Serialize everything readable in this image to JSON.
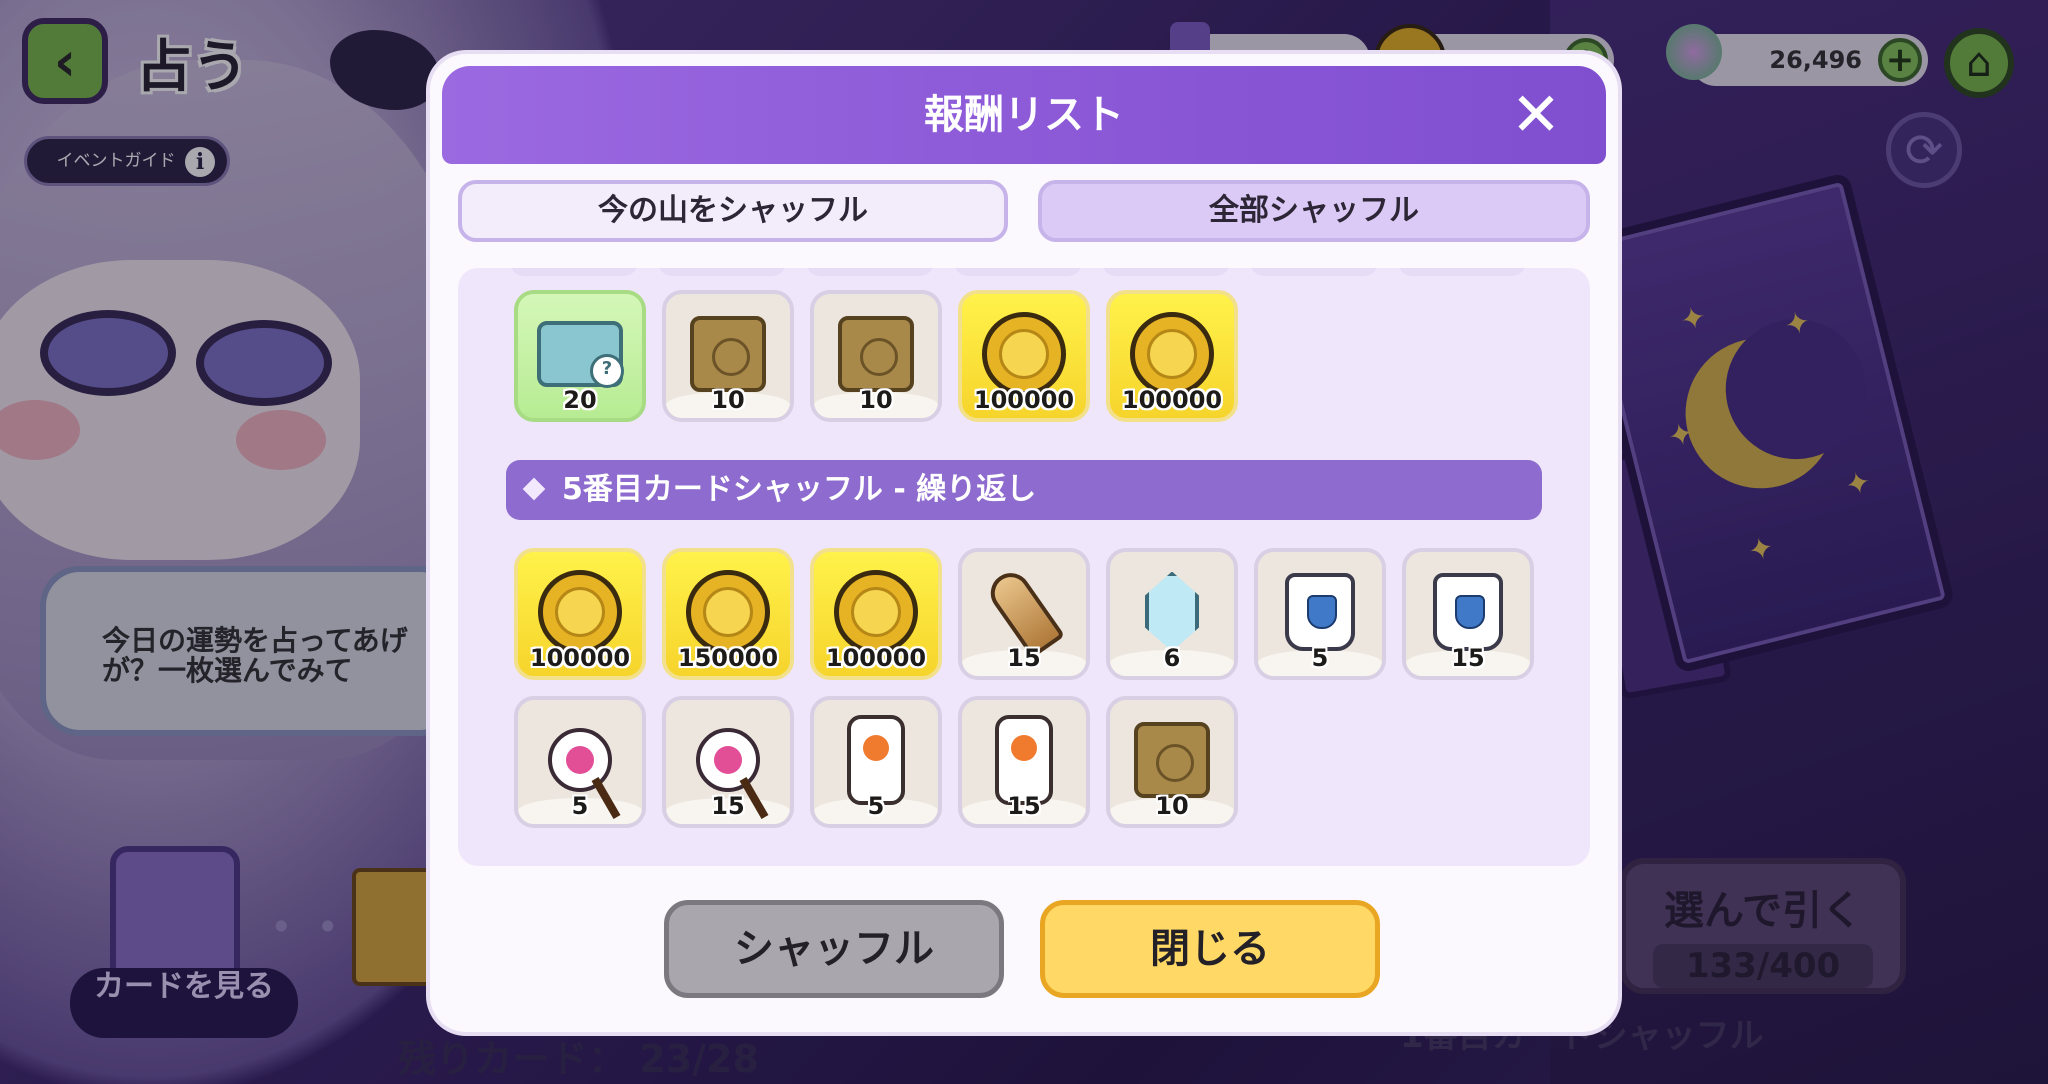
{
  "screen": {
    "title": "占う",
    "event_guide": "イベントガイド",
    "currencies": [
      {
        "name": "ticket",
        "value": ""
      },
      {
        "name": "coin",
        "value": ""
      },
      {
        "name": "gem",
        "value": "26,496"
      }
    ],
    "speech": "今日の運勢を占ってあげ\nが？一枚選んでみて",
    "see_card": "カードを見る",
    "remaining_label": "残りカード：",
    "remaining_value": "23/28",
    "draw_button": "選んで引く",
    "draw_count": "133/400",
    "bottom_hint": "1番目カードシャッフル"
  },
  "modal": {
    "title": "報酬リスト",
    "tabs": [
      {
        "label": "今の山をシャッフル",
        "selected": false
      },
      {
        "label": "全部シャッフル",
        "selected": true
      }
    ],
    "top_row": [
      {
        "icon": "toolbox-icon",
        "qty": "20",
        "bg": "green"
      },
      {
        "icon": "chip-icon",
        "qty": "10",
        "bg": "plain"
      },
      {
        "icon": "chip-icon",
        "qty": "10",
        "bg": "plain"
      },
      {
        "icon": "coin-icon",
        "qty": "100000",
        "bg": "gold"
      },
      {
        "icon": "coin-icon",
        "qty": "100000",
        "bg": "gold"
      }
    ],
    "section_title": "5番目カードシャッフル - 繰り返し",
    "row2": [
      {
        "icon": "coin-icon",
        "qty": "100000",
        "bg": "gold"
      },
      {
        "icon": "coin-icon",
        "qty": "150000",
        "bg": "gold"
      },
      {
        "icon": "coin-icon",
        "qty": "100000",
        "bg": "gold"
      },
      {
        "icon": "bullet-icon",
        "qty": "15",
        "bg": "plain"
      },
      {
        "icon": "crystal-icon",
        "qty": "6",
        "bg": "plain"
      },
      {
        "icon": "cup-icon",
        "qty": "5",
        "bg": "plain"
      },
      {
        "icon": "cup-icon",
        "qty": "15",
        "bg": "plain"
      }
    ],
    "row3": [
      {
        "icon": "fan-icon",
        "qty": "5",
        "bg": "plain"
      },
      {
        "icon": "fan-icon",
        "qty": "15",
        "bg": "plain"
      },
      {
        "icon": "scroll-icon",
        "qty": "5",
        "bg": "plain"
      },
      {
        "icon": "scroll-icon",
        "qty": "15",
        "bg": "plain"
      },
      {
        "icon": "chip-icon",
        "qty": "10",
        "bg": "plain"
      }
    ],
    "shuffle_button": "シャッフル",
    "close_button": "閉じる"
  },
  "colors": {
    "header_purple": "#8a57d6",
    "section_purple": "#8e6ccf",
    "close_yellow": "#ffd866",
    "shuffle_gray": "#a9a6ad"
  }
}
